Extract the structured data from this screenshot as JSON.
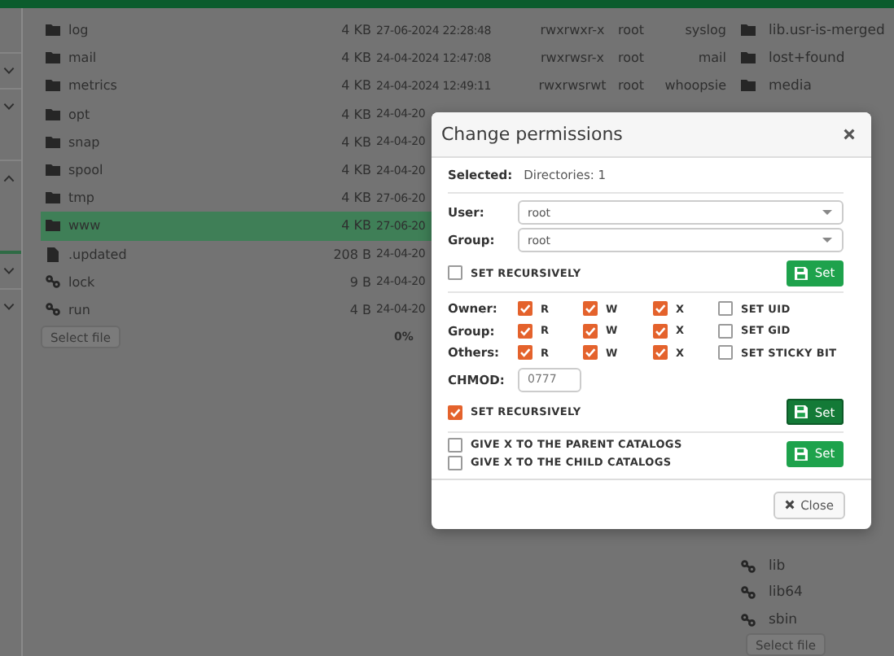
{
  "sidebar": {
    "toggles": [
      {
        "expanded": false
      },
      {
        "expanded": false
      },
      {
        "expanded": true
      },
      {
        "expanded": false
      },
      {
        "expanded": false
      }
    ]
  },
  "files": {
    "rows": [
      {
        "name": "log",
        "kind": "folder",
        "size": "4 KB",
        "modified": "27-06-2024 22:28:48",
        "permissions": "rwxrwxr-x",
        "owner": "root",
        "group": "syslog",
        "selected": false
      },
      {
        "name": "mail",
        "kind": "folder",
        "size": "4 KB",
        "modified": "24-04-2024 12:47:08",
        "permissions": "rwxrwsr-x",
        "owner": "root",
        "group": "mail",
        "selected": false
      },
      {
        "name": "metrics",
        "kind": "folder",
        "size": "4 KB",
        "modified": "24-04-2024 12:49:11",
        "permissions": "rwxrwsrwt",
        "owner": "root",
        "group": "whoopsie",
        "selected": false
      },
      {
        "name": "opt",
        "kind": "folder",
        "size": "4 KB",
        "modified": "24-04-20",
        "selected": false
      },
      {
        "name": "snap",
        "kind": "folder",
        "size": "4 KB",
        "modified": "24-04-20",
        "selected": false
      },
      {
        "name": "spool",
        "kind": "folder",
        "size": "4 KB",
        "modified": "24-04-20",
        "selected": false
      },
      {
        "name": "tmp",
        "kind": "folder",
        "size": "4 KB",
        "modified": "27-06-20",
        "selected": false
      },
      {
        "name": "www",
        "kind": "folder",
        "size": "4 KB",
        "modified": "27-06-20",
        "selected": true
      },
      {
        "name": ".updated",
        "kind": "file",
        "size": "208 B",
        "modified": "24-04-20",
        "selected": false
      },
      {
        "name": "lock",
        "kind": "link",
        "size": "9 B",
        "modified": "24-04-20",
        "selected": false
      },
      {
        "name": "run",
        "kind": "link",
        "size": "4 B",
        "modified": "24-04-20",
        "selected": false
      }
    ],
    "select_button": "Select file",
    "progress": "0%"
  },
  "right_panel": {
    "top_items": [
      {
        "name": "lib.usr-is-merged",
        "kind": "folder"
      },
      {
        "name": "lost+found",
        "kind": "folder"
      },
      {
        "name": "media",
        "kind": "folder"
      }
    ],
    "bottom_items": [
      {
        "name": "lib",
        "kind": "link"
      },
      {
        "name": "lib64",
        "kind": "link"
      },
      {
        "name": "sbin",
        "kind": "link"
      }
    ],
    "select_button": "Select file"
  },
  "dialog": {
    "title": "Change permissions",
    "selected_label": "Selected:",
    "selected_value": "Directories: 1",
    "user": {
      "label": "User:",
      "value": "root"
    },
    "group": {
      "label": "Group:",
      "value": "root"
    },
    "owner_recursive": {
      "label": "SET RECURSIVELY",
      "checked": false
    },
    "owner_set_button": {
      "label": "Set",
      "hovered": false
    },
    "permissions": [
      {
        "label": "Owner:",
        "flags": [
          {
            "label": "R",
            "checked": true
          },
          {
            "label": "W",
            "checked": true
          },
          {
            "label": "X",
            "checked": true
          },
          {
            "label": "SET UID",
            "checked": false
          }
        ]
      },
      {
        "label": "Group:",
        "flags": [
          {
            "label": "R",
            "checked": true
          },
          {
            "label": "W",
            "checked": true
          },
          {
            "label": "X",
            "checked": true
          },
          {
            "label": "SET GID",
            "checked": false
          }
        ]
      },
      {
        "label": "Others:",
        "flags": [
          {
            "label": "R",
            "checked": true
          },
          {
            "label": "W",
            "checked": true
          },
          {
            "label": "X",
            "checked": true
          },
          {
            "label": "SET STICKY BIT",
            "checked": false
          }
        ]
      }
    ],
    "chmod": {
      "label": "CHMOD:",
      "value": "0777"
    },
    "mode_recursive": {
      "label": "SET RECURSIVELY",
      "checked": true
    },
    "mode_set_button": {
      "label": "Set",
      "hovered": true
    },
    "give_x": [
      {
        "label": "GIVE X TO THE PARENT CATALOGS",
        "checked": false
      },
      {
        "label": "GIVE X TO THE CHILD CATALOGS",
        "checked": false
      }
    ],
    "give_x_set_button": {
      "label": "Set",
      "hovered": false
    },
    "close_button": "Close"
  }
}
